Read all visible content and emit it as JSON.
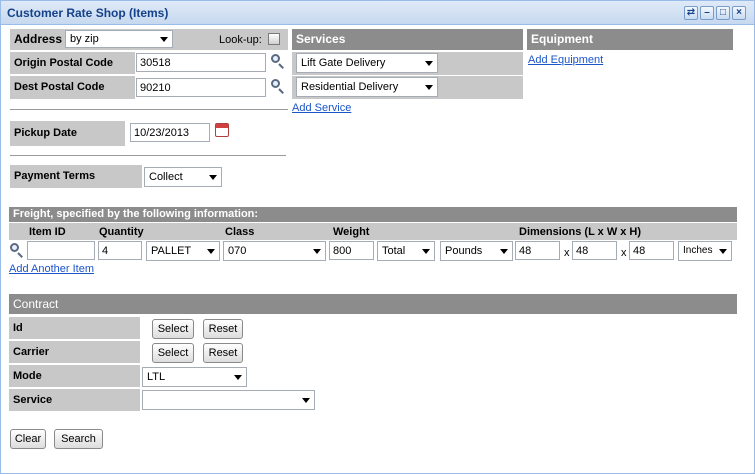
{
  "window": {
    "title": "Customer Rate Shop (Items)"
  },
  "address": {
    "header_label": "Address",
    "mode_value": "by zip",
    "lookup_label": "Look-up:",
    "origin_label": "Origin Postal Code",
    "origin_value": "30518",
    "dest_label": "Dest Postal Code",
    "dest_value": "90210"
  },
  "services": {
    "header": "Services",
    "items": [
      "Lift Gate Delivery",
      "Residential Delivery"
    ],
    "add_link": "Add Service"
  },
  "equipment": {
    "header": "Equipment",
    "add_link": "Add Equipment"
  },
  "pickup": {
    "label": "Pickup Date",
    "value": "10/23/2013"
  },
  "payment": {
    "label": "Payment Terms",
    "value": "Collect"
  },
  "freight": {
    "header": "Freight, specified by the following information:",
    "columns": {
      "item_id": "Item ID",
      "quantity": "Quantity",
      "class": "Class",
      "weight": "Weight",
      "dimensions": "Dimensions (L x W x H)"
    },
    "row": {
      "item_id": "",
      "quantity": "4",
      "unit": "PALLET",
      "class": "070",
      "weight": "800",
      "weight_type": "Total",
      "weight_unit": "Pounds",
      "length": "48",
      "width": "48",
      "height": "48",
      "dim_unit": "Inches"
    },
    "separator": "x",
    "add_link": "Add Another Item"
  },
  "contract": {
    "header": "Contract",
    "id_label": "Id",
    "carrier_label": "Carrier",
    "mode_label": "Mode",
    "mode_value": "LTL",
    "service_label": "Service",
    "service_value": "",
    "select_label": "Select",
    "reset_label": "Reset"
  },
  "actions": {
    "clear": "Clear",
    "search": "Search"
  }
}
